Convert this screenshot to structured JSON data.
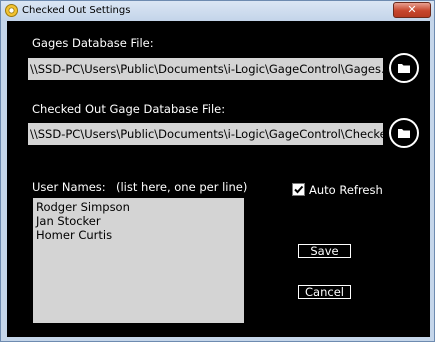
{
  "window": {
    "title": "Checked Out Settings",
    "close_label": "✕"
  },
  "gages_db": {
    "label": "Gages Database File:",
    "value": "\\\\SSD-PC\\Users\\Public\\Documents\\i-Logic\\GageControl\\Gages.mdb",
    "browse_icon": "folder-icon"
  },
  "checked_out_db": {
    "label": "Checked Out Gage Database File:",
    "value": "\\\\SSD-PC\\Users\\Public\\Documents\\i-Logic\\GageControl\\CheckedOut.mdb",
    "browse_icon": "folder-icon"
  },
  "users": {
    "label": "User Names:",
    "hint": "(list here, one per line)",
    "names": [
      "Rodger Simpson",
      "Jan Stocker",
      "Homer Curtis"
    ]
  },
  "auto_refresh": {
    "label": "Auto Refresh",
    "checked": true
  },
  "buttons": {
    "save": "Save",
    "cancel": "Cancel"
  },
  "colors": {
    "client_background": "#000000",
    "field_background": "#d4d4d4",
    "text": "#ffffff",
    "frame": "#c5d6ea",
    "close_button": "#c7462d"
  }
}
